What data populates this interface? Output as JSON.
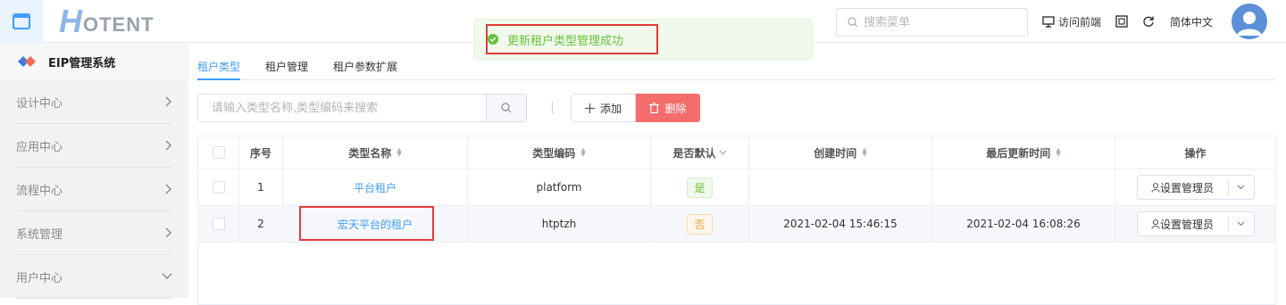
{
  "header": {
    "logo_h": "H",
    "logo_rest": "OTENT",
    "search_placeholder": "搜索菜单",
    "visit_front": "访问前端",
    "language": "简体中文",
    "colors": {
      "accent": "#409eff",
      "logo": "#8bb6e6"
    }
  },
  "toast": {
    "message": "更新租户类型管理成功",
    "icon": "check-circle-icon",
    "color": "#67c23a"
  },
  "sidebar": {
    "system_name": "EIP管理系统",
    "items": [
      {
        "label": "设计中心",
        "icon": "chevron-right-icon"
      },
      {
        "label": "应用中心",
        "icon": "chevron-right-icon"
      },
      {
        "label": "流程中心",
        "icon": "chevron-right-icon"
      },
      {
        "label": "系统管理",
        "icon": "chevron-right-icon"
      },
      {
        "label": "用户中心",
        "icon": "chevron-down-icon"
      }
    ]
  },
  "tabs": [
    {
      "label": "租户类型",
      "active": true
    },
    {
      "label": "租户管理",
      "active": false
    },
    {
      "label": "租户参数扩展",
      "active": false
    }
  ],
  "toolbar": {
    "search_placeholder": "请输入类型名称,类型编码来搜索",
    "add_label": "添加",
    "delete_label": "删除"
  },
  "table": {
    "columns": [
      "序号",
      "类型名称",
      "类型编码",
      "是否默认",
      "创建时间",
      "最后更新时间",
      "操作"
    ],
    "rows": [
      {
        "index": "1",
        "name": "平台租户",
        "code": "platform",
        "is_default": "是",
        "created": "",
        "updated": "",
        "action": "设置管理员"
      },
      {
        "index": "2",
        "name": "宏天平台的租户",
        "code": "htptzh",
        "is_default": "否",
        "created": "2021-02-04 15:46:15",
        "updated": "2021-02-04 16:08:26",
        "action": "设置管理员"
      }
    ]
  }
}
